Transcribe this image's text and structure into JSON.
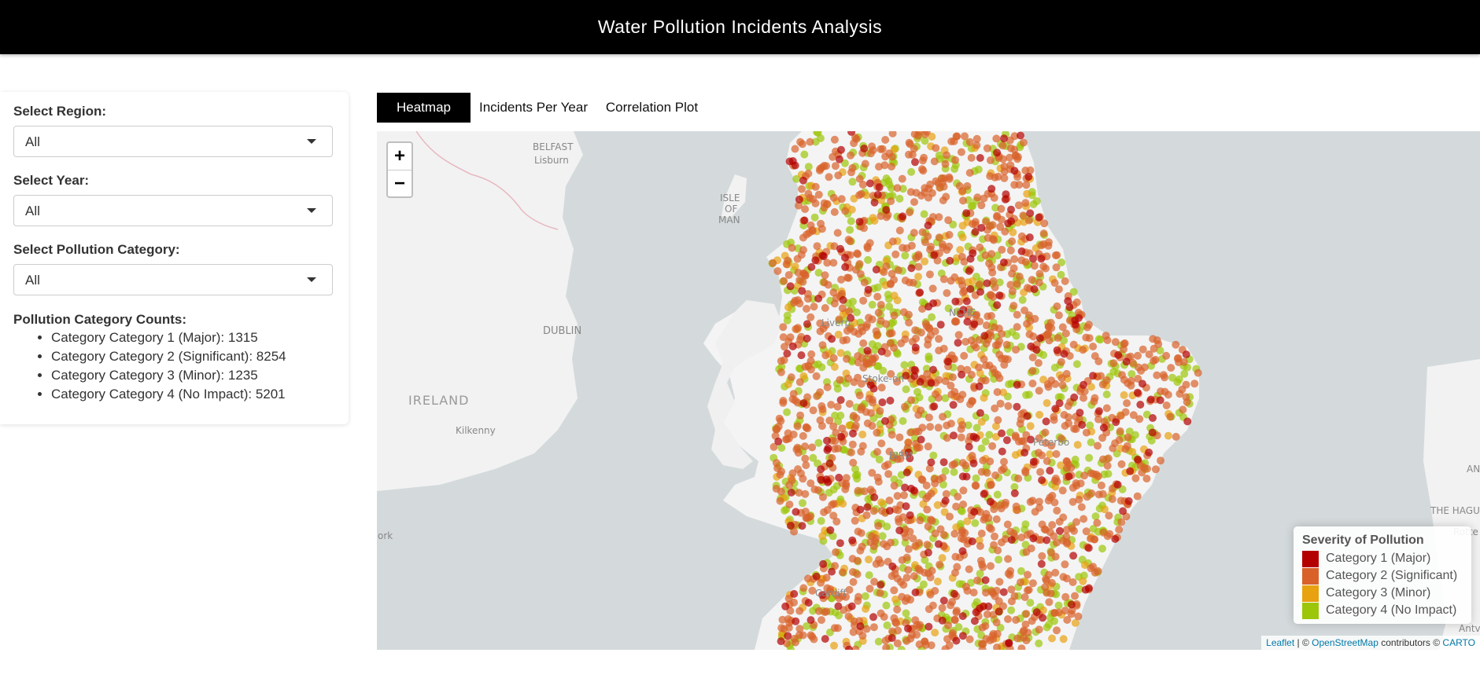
{
  "app": {
    "title": "Water Pollution Incidents Analysis"
  },
  "sidebar": {
    "region": {
      "label": "Select Region:",
      "value": "All"
    },
    "year": {
      "label": "Select Year:",
      "value": "All"
    },
    "category": {
      "label": "Select Pollution Category:",
      "value": "All"
    },
    "counts_title": "Pollution Category Counts:",
    "counts": [
      "Category Category 1 (Major): 1315",
      "Category Category 2 (Significant): 8254",
      "Category Category 3 (Minor): 1235",
      "Category Category 4 (No Impact): 5201"
    ]
  },
  "tabs": [
    {
      "label": "Heatmap",
      "active": true
    },
    {
      "label": "Incidents Per Year",
      "active": false
    },
    {
      "label": "Correlation Plot",
      "active": false
    }
  ],
  "map": {
    "zoom_in": "+",
    "zoom_out": "−",
    "places": [
      "BELFAST",
      "Lisburn",
      "ISLE",
      "OF",
      "MAN",
      "DUBLIN",
      "IRELAND",
      "Kilkenny",
      "Liverp",
      "NCHE",
      "Stoke-on",
      "BIRM",
      "Peterbo",
      "Cardiff",
      "ork",
      "AN",
      "THE HAGU",
      "Rotte",
      "Antv"
    ],
    "legend": {
      "title": "Severity of Pollution",
      "items": [
        {
          "label": "Category 1 (Major)",
          "color": "#b30000"
        },
        {
          "label": "Category 2 (Significant)",
          "color": "#d9622b"
        },
        {
          "label": "Category 3 (Minor)",
          "color": "#e8a10f"
        },
        {
          "label": "Category 4 (No Impact)",
          "color": "#9cc60a"
        }
      ]
    },
    "attribution": {
      "leaflet": "Leaflet",
      "sep": " | © ",
      "osm": "OpenStreetMap",
      "mid": " contributors © ",
      "carto": "CARTO"
    }
  }
}
